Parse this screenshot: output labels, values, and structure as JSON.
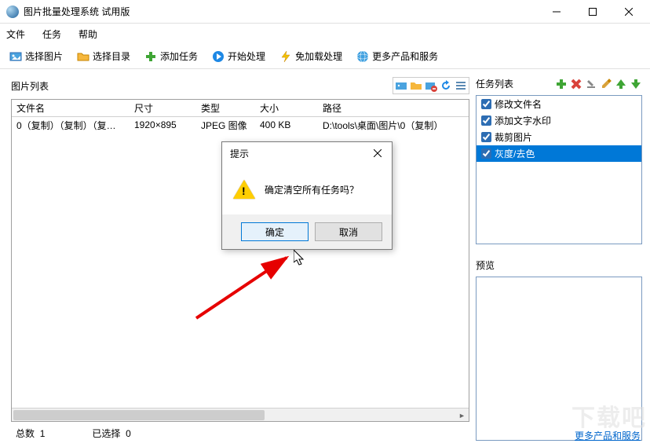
{
  "window": {
    "title": "图片批量处理系统 试用版"
  },
  "menu": {
    "file": "文件",
    "task": "任务",
    "help": "帮助"
  },
  "toolbar": {
    "select_image": "选择图片",
    "select_dir": "选择目录",
    "add_task": "添加任务",
    "start": "开始处理",
    "no_load": "免加载处理",
    "more": "更多产品和服务"
  },
  "left": {
    "list_title": "图片列表",
    "columns": {
      "name": "文件名",
      "dim": "尺寸",
      "type": "类型",
      "size": "大小",
      "path": "路径"
    },
    "rows": [
      {
        "name": "0（复制）（复制）（复…",
        "dim": "1920×895",
        "type": "JPEG 图像",
        "size": "400 KB",
        "path": "D:\\tools\\桌面\\图片\\0（复制）"
      }
    ],
    "status_total_label": "总数",
    "status_total_value": "1",
    "status_sel_label": "已选择",
    "status_sel_value": "0"
  },
  "right": {
    "list_title": "任务列表",
    "items": [
      {
        "label": "修改文件名",
        "selected": false
      },
      {
        "label": "添加文字水印",
        "selected": false
      },
      {
        "label": "裁剪图片",
        "selected": false
      },
      {
        "label": "灰度/去色",
        "selected": true
      }
    ],
    "preview_label": "预览"
  },
  "dialog": {
    "title": "提示",
    "message": "确定清空所有任务吗？",
    "ok": "确定",
    "cancel": "取消"
  },
  "footer_link": "更多产品和服务",
  "watermark": "下载吧"
}
